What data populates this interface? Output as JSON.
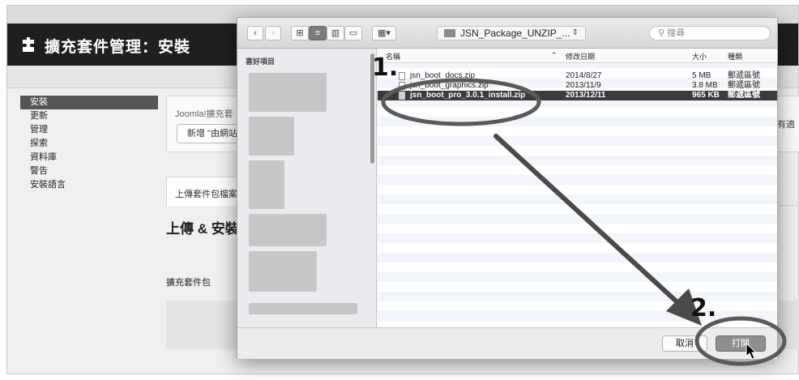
{
  "page": {
    "header_title": "擴充套件管理：安裝",
    "sidebar_items": [
      "安裝",
      "更新",
      "管理",
      "探索",
      "資料庫",
      "警告",
      "安裝語言"
    ],
    "message_text": "Joomla!擴充套",
    "add_button_label": "新增 \"由網站",
    "right_text": "所有適",
    "tab_label": "上傳套件包檔案",
    "upload_title": "上傳 & 安裝",
    "package_label": "擴充套件包"
  },
  "dialog": {
    "folder_name": "JSN_Package_UNZIP_...",
    "search_placeholder": "搜尋",
    "favorites_label": "喜好項目",
    "columns": {
      "name": "名稱",
      "date": "修改日期",
      "size": "大小",
      "kind": "種類"
    },
    "files": [
      {
        "name": "jsn_boot_docs.zip",
        "date": "2014/8/27",
        "size": "5 MB",
        "kind": "郵遞區號"
      },
      {
        "name": "jsn_boot_graphics.zip",
        "date": "2013/11/9",
        "size": "3.8 MB",
        "kind": "郵遞區號"
      },
      {
        "name": "jsn_boot_pro_3.0.1_install.zip",
        "date": "2013/12/11",
        "size": "965 KB",
        "kind": "郵遞區號"
      }
    ],
    "selected_index": 2,
    "cancel_label": "取消",
    "open_label": "打開"
  },
  "annotations": {
    "step1": "1.",
    "step2": "2.",
    "color": "#5a5a5a"
  },
  "colors": {
    "header_bg": "#1f1f1f",
    "selection": "#3b3b3b",
    "sidebar_active": "#555555"
  }
}
